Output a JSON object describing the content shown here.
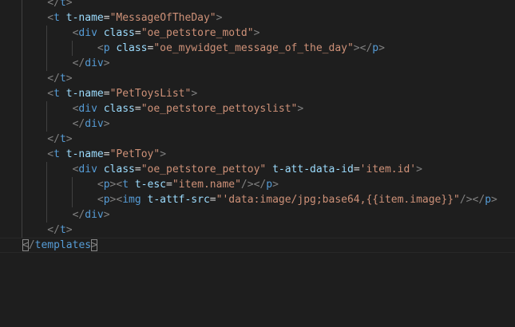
{
  "colors": {
    "background": "#1e1e1e",
    "punctuation": "#808080",
    "tag": "#569cd6",
    "attribute": "#9cdcfe",
    "string": "#ce9178",
    "text": "#d4d4d4"
  },
  "editor": {
    "lines": [
      {
        "indent": 1,
        "tokens": [
          [
            "punc",
            "</"
          ],
          [
            "tag",
            "t"
          ],
          [
            "punc",
            ">"
          ]
        ]
      },
      {
        "indent": 1,
        "tokens": [
          [
            "punc",
            "<"
          ],
          [
            "tag",
            "t"
          ],
          [
            "text",
            " "
          ],
          [
            "attr",
            "t-name"
          ],
          [
            "text",
            "="
          ],
          [
            "str",
            "\"MessageOfTheDay\""
          ],
          [
            "punc",
            ">"
          ]
        ]
      },
      {
        "indent": 2,
        "tokens": [
          [
            "punc",
            "<"
          ],
          [
            "tag",
            "div"
          ],
          [
            "text",
            " "
          ],
          [
            "attr",
            "class"
          ],
          [
            "text",
            "="
          ],
          [
            "str",
            "\"oe_petstore_motd\""
          ],
          [
            "punc",
            ">"
          ]
        ]
      },
      {
        "indent": 3,
        "tokens": [
          [
            "punc",
            "<"
          ],
          [
            "tag",
            "p"
          ],
          [
            "text",
            " "
          ],
          [
            "attr",
            "class"
          ],
          [
            "text",
            "="
          ],
          [
            "str",
            "\"oe_mywidget_message_of_the_day\""
          ],
          [
            "punc",
            "></"
          ],
          [
            "tag",
            "p"
          ],
          [
            "punc",
            ">"
          ]
        ]
      },
      {
        "indent": 2,
        "tokens": [
          [
            "punc",
            "</"
          ],
          [
            "tag",
            "div"
          ],
          [
            "punc",
            ">"
          ]
        ]
      },
      {
        "indent": 1,
        "tokens": [
          [
            "punc",
            "</"
          ],
          [
            "tag",
            "t"
          ],
          [
            "punc",
            ">"
          ]
        ]
      },
      {
        "indent": 1,
        "tokens": [
          [
            "punc",
            "<"
          ],
          [
            "tag",
            "t"
          ],
          [
            "text",
            " "
          ],
          [
            "attr",
            "t-name"
          ],
          [
            "text",
            "="
          ],
          [
            "str",
            "\"PetToysList\""
          ],
          [
            "punc",
            ">"
          ]
        ]
      },
      {
        "indent": 2,
        "tokens": [
          [
            "punc",
            "<"
          ],
          [
            "tag",
            "div"
          ],
          [
            "text",
            " "
          ],
          [
            "attr",
            "class"
          ],
          [
            "text",
            "="
          ],
          [
            "str",
            "\"oe_petstore_pettoyslist\""
          ],
          [
            "punc",
            ">"
          ]
        ]
      },
      {
        "indent": 2,
        "tokens": [
          [
            "punc",
            "</"
          ],
          [
            "tag",
            "div"
          ],
          [
            "punc",
            ">"
          ]
        ]
      },
      {
        "indent": 1,
        "tokens": [
          [
            "punc",
            "</"
          ],
          [
            "tag",
            "t"
          ],
          [
            "punc",
            ">"
          ]
        ]
      },
      {
        "indent": 1,
        "tokens": [
          [
            "punc",
            "<"
          ],
          [
            "tag",
            "t"
          ],
          [
            "text",
            " "
          ],
          [
            "attr",
            "t-name"
          ],
          [
            "text",
            "="
          ],
          [
            "str",
            "\"PetToy\""
          ],
          [
            "punc",
            ">"
          ]
        ]
      },
      {
        "indent": 2,
        "tokens": [
          [
            "punc",
            "<"
          ],
          [
            "tag",
            "div"
          ],
          [
            "text",
            " "
          ],
          [
            "attr",
            "class"
          ],
          [
            "text",
            "="
          ],
          [
            "str",
            "\"oe_petstore_pettoy\""
          ],
          [
            "text",
            " "
          ],
          [
            "attr",
            "t-att-data-id"
          ],
          [
            "text",
            "="
          ],
          [
            "str",
            "'item.id'"
          ],
          [
            "punc",
            ">"
          ]
        ]
      },
      {
        "indent": 3,
        "tokens": [
          [
            "punc",
            "<"
          ],
          [
            "tag",
            "p"
          ],
          [
            "punc",
            "><"
          ],
          [
            "tag",
            "t"
          ],
          [
            "text",
            " "
          ],
          [
            "attr",
            "t-esc"
          ],
          [
            "text",
            "="
          ],
          [
            "str",
            "\"item.name\""
          ],
          [
            "punc",
            "/></"
          ],
          [
            "tag",
            "p"
          ],
          [
            "punc",
            ">"
          ]
        ]
      },
      {
        "indent": 3,
        "tokens": [
          [
            "punc",
            "<"
          ],
          [
            "tag",
            "p"
          ],
          [
            "punc",
            "><"
          ],
          [
            "tag",
            "img"
          ],
          [
            "text",
            " "
          ],
          [
            "attr",
            "t-attf-src"
          ],
          [
            "text",
            "="
          ],
          [
            "str",
            "\"'data:image/jpg;base64,{{item.image}}\""
          ],
          [
            "punc",
            "/></"
          ],
          [
            "tag",
            "p"
          ],
          [
            "punc",
            ">"
          ]
        ]
      },
      {
        "indent": 2,
        "tokens": [
          [
            "punc",
            "</"
          ],
          [
            "tag",
            "div"
          ],
          [
            "punc",
            ">"
          ]
        ]
      },
      {
        "indent": 1,
        "tokens": [
          [
            "punc",
            "</"
          ],
          [
            "tag",
            "t"
          ],
          [
            "punc",
            ">"
          ]
        ]
      },
      {
        "indent": 0,
        "current": true,
        "tokens": [
          [
            "punc-match",
            "<"
          ],
          [
            "punc",
            "/"
          ],
          [
            "tag",
            "templates"
          ],
          [
            "punc-match",
            ">"
          ]
        ]
      }
    ]
  }
}
